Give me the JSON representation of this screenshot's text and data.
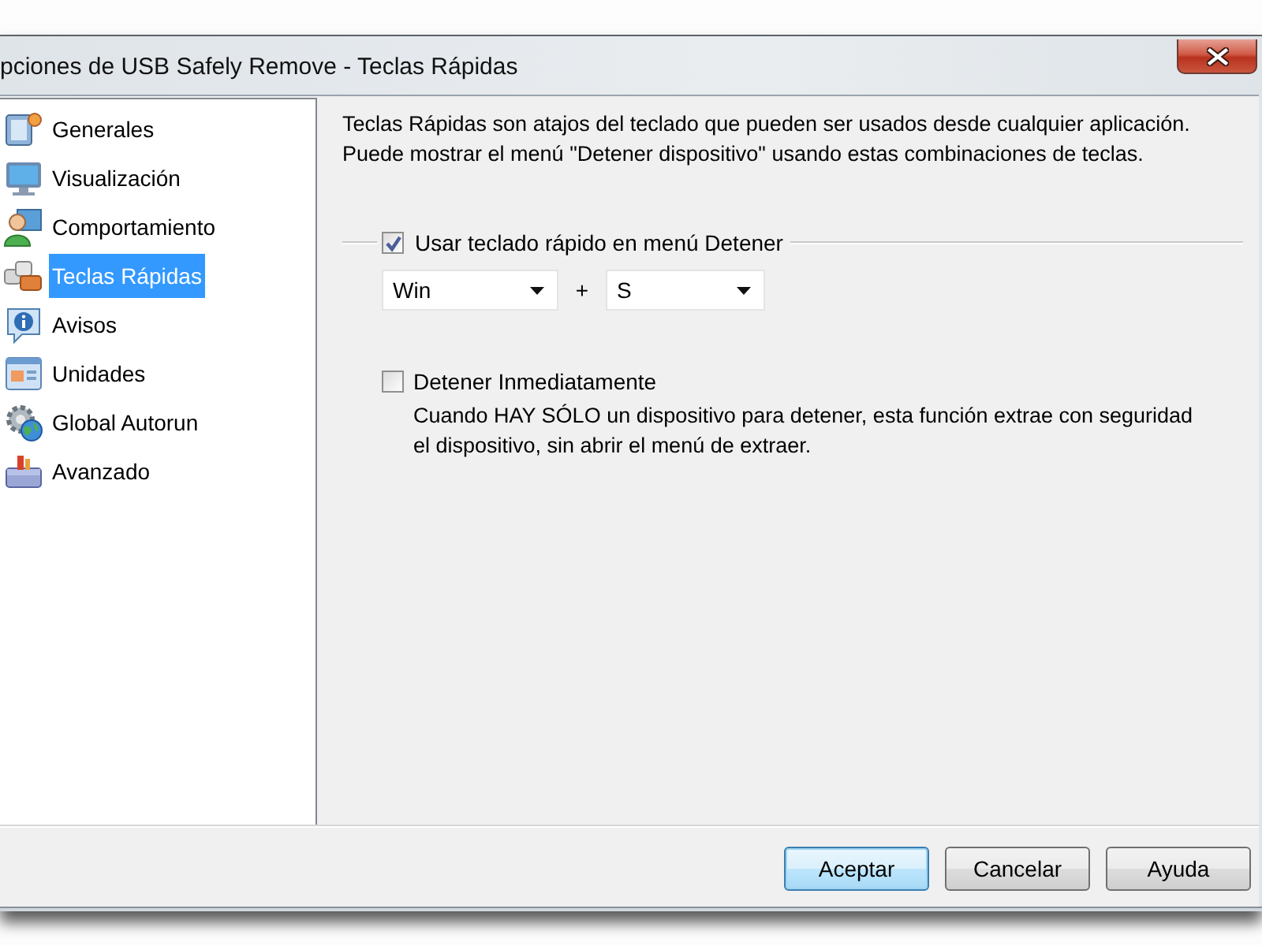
{
  "window": {
    "title": "pciones de USB Safely Remove - Teclas Rápidas"
  },
  "sidebar": {
    "items": [
      {
        "label": "Generales",
        "selected": false
      },
      {
        "label": "Visualización",
        "selected": false
      },
      {
        "label": "Comportamiento",
        "selected": false
      },
      {
        "label": "Teclas Rápidas",
        "selected": true
      },
      {
        "label": "Avisos",
        "selected": false
      },
      {
        "label": "Unidades",
        "selected": false
      },
      {
        "label": "Global Autorun",
        "selected": false
      },
      {
        "label": "Avanzado",
        "selected": false
      }
    ]
  },
  "content": {
    "description": [
      "Teclas Rápidas son atajos del teclado que pueden ser usados desde cualquier aplicación.",
      "Puede mostrar el menú \"Detener dispositivo\" usando estas combinaciones de teclas."
    ],
    "hotkey": {
      "label": "Usar teclado rápido en menú Detener",
      "checked": true,
      "modifier": "Win",
      "plus": "+",
      "key": "S"
    },
    "stop_immediately": {
      "label": "Detener Inmediatamente",
      "checked": false,
      "description": [
        "Cuando HAY SÓLO un dispositivo para detener, esta función extrae con seguridad",
        "el dispositivo, sin abrir el menú de extraer."
      ]
    }
  },
  "buttons": [
    {
      "label": "Aceptar",
      "focused": true
    },
    {
      "label": "Cancelar",
      "focused": false
    },
    {
      "label": "Ayuda",
      "focused": false
    }
  ]
}
